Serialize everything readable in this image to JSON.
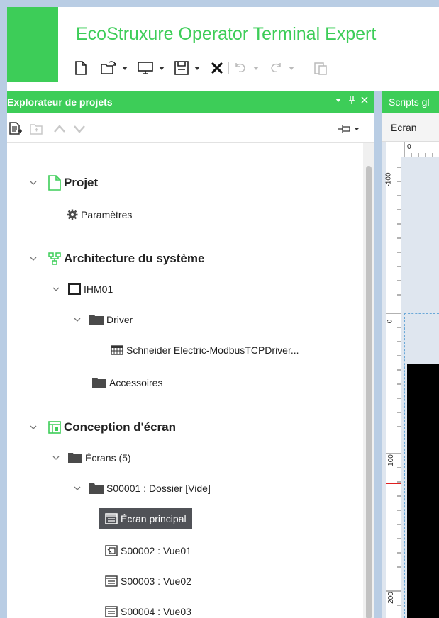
{
  "app": {
    "title": "EcoStruxure Operator Terminal Expert",
    "brand_color": "#3dcd58",
    "toolbar": [
      {
        "icon": "new-file-icon"
      },
      {
        "icon": "open-folder-icon",
        "dropdown": true
      },
      {
        "icon": "monitor-icon",
        "dropdown": true
      },
      {
        "icon": "save-icon",
        "dropdown": true
      },
      {
        "icon": "delete-icon"
      },
      {
        "icon": "undo-icon",
        "dropdown": true,
        "disabled": true
      },
      {
        "icon": "redo-icon",
        "dropdown": true,
        "disabled": true
      },
      {
        "icon": "paste-icon",
        "disabled": true
      }
    ]
  },
  "explorer": {
    "title": "Explorateur de projets",
    "controls": [
      "▾",
      "ᵽ",
      "✕"
    ],
    "pin_icon": "pin-icon"
  },
  "tree": {
    "projet": "Projet",
    "parametres": "Paramètres",
    "architecture": "Architecture du système",
    "ihm": "IHM01",
    "driver": "Driver",
    "driver_item": "Schneider Electric-ModbusTCPDriver...",
    "accessoires": "Accessoires",
    "conception": "Conception d'écran",
    "ecrans": "Écrans (5)",
    "dossier": "S00001 : Dossier [Vide]",
    "ecran_principal": "Écran principal",
    "vue01": "S00002 : Vue01",
    "vue02": "S00003 : Vue02",
    "vue03": "S00004 : Vue03"
  },
  "editor": {
    "tab_label": "Scripts gl",
    "bar_label": "Écran",
    "ruler_h": [
      "0"
    ],
    "ruler_v": [
      "-100",
      "0",
      "100",
      "200"
    ]
  }
}
